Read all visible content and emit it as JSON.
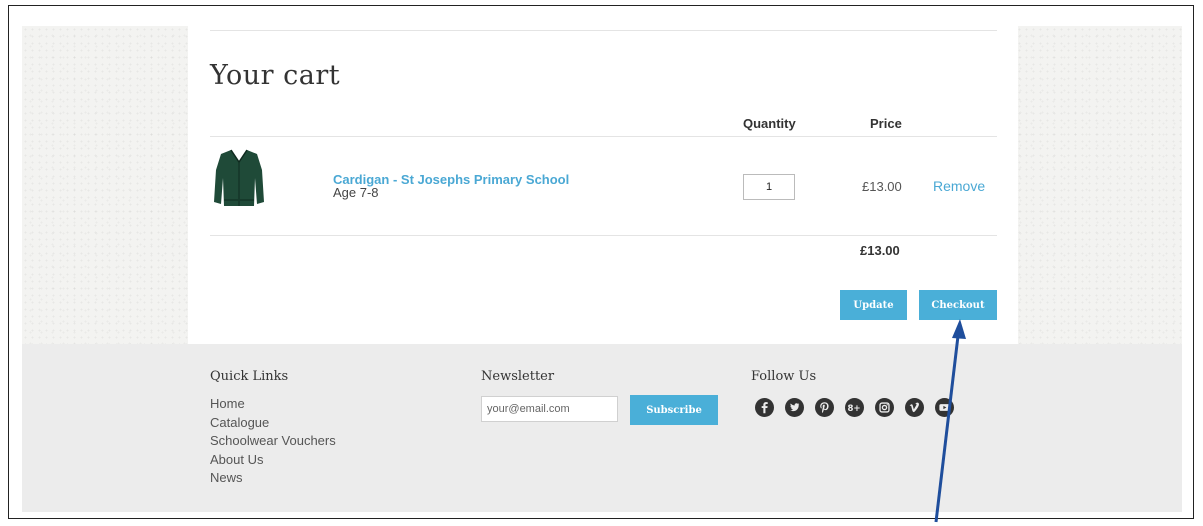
{
  "cart": {
    "title": "Your cart",
    "columns": {
      "quantity": "Quantity",
      "price": "Price"
    },
    "items": [
      {
        "name": "Cardigan - St Josephs Primary School",
        "variant": "Age 7-8",
        "quantity": "1",
        "price": "£13.00",
        "remove_label": "Remove",
        "thumbnail_icon": "green-cardigan"
      }
    ],
    "total": "£13.00",
    "update_label": "Update",
    "checkout_label": "Checkout"
  },
  "footer": {
    "quick_links_title": "Quick Links",
    "quick_links": [
      "Home",
      "Catalogue",
      "Schoolwear Vouchers",
      "About Us",
      "News"
    ],
    "newsletter_title": "Newsletter",
    "newsletter_placeholder": "your@email.com",
    "subscribe_label": "Subscribe",
    "follow_title": "Follow Us",
    "social_icons": [
      "facebook-icon",
      "twitter-icon",
      "pinterest-icon",
      "google-plus-icon",
      "instagram-icon",
      "vimeo-icon",
      "youtube-icon"
    ]
  },
  "colors": {
    "accent": "#4aafd8",
    "link": "#4aa8d4",
    "footer_bg": "#ececec",
    "icon": "#333333",
    "annotation_arrow": "#1f4e9c"
  }
}
